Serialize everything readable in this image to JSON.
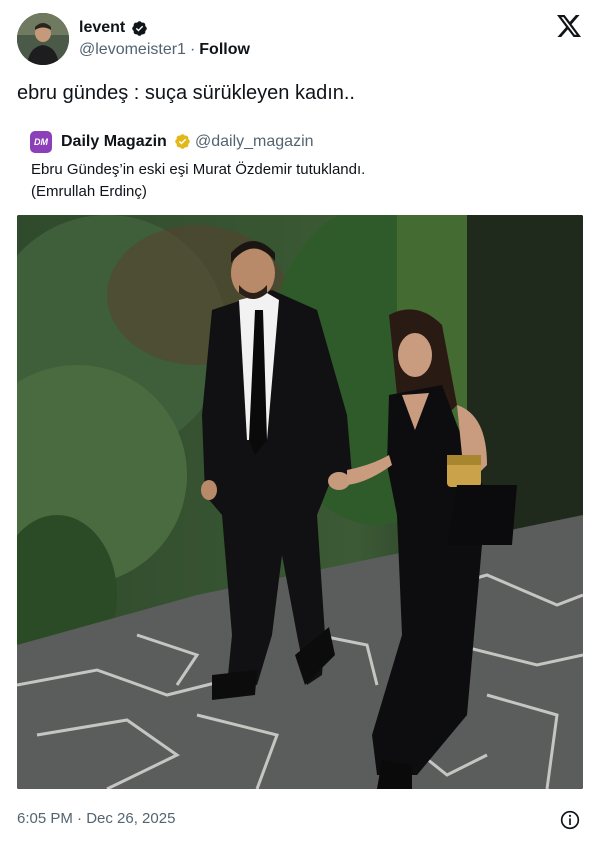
{
  "author": {
    "display_name": "levent",
    "handle": "@levomeister1",
    "separator": "·",
    "follow_label": "Follow"
  },
  "tweet": {
    "text": "ebru gündeş : suça sürükleyen kadın.."
  },
  "quote": {
    "avatar_initials": "DM",
    "display_name": "Daily Magazin",
    "handle": "@daily_magazin",
    "text_line1": "Ebru Gündeş’in eski eşi Murat Özdemir tutuklandı.",
    "text_line2": "(Emrullah Erdinç)"
  },
  "footer": {
    "timestamp": "6:05 PM · Dec 26, 2025"
  },
  "icons": {
    "verified": "verified-badge-icon",
    "gold_verified": "gold-verified-badge-icon",
    "brand": "x-logo-icon",
    "info": "info-icon"
  },
  "colors": {
    "text_primary": "#0f1419",
    "text_secondary": "#536471",
    "verified_blue": "#1d9bf0",
    "verified_gold": "#e2b719",
    "quote_avatar_bg": "#8b3fb8"
  }
}
